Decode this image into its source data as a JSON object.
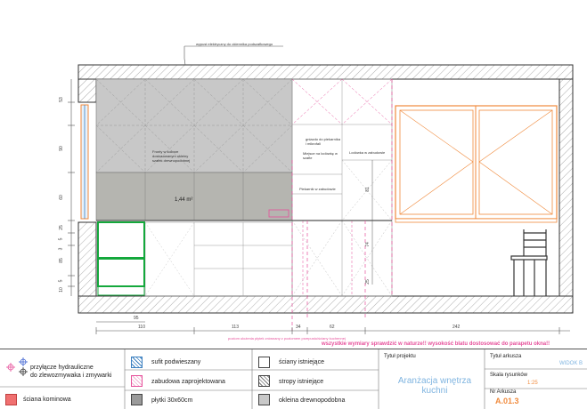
{
  "annotations": {
    "top_note": "wypust elektryczny do okiennika podszafkowego",
    "cabinet_note": "Fronty w kolorze dostosowanym okleiny szafek drewnopodobnej",
    "area": "1,44 m²",
    "oven_note": "gniazdo do piekarnika i mikrofali",
    "fridge_note": "Miejsce na lodówkę w szafie",
    "washer_note": "Lodówka w zabudowie",
    "piekarnik": "Piekarnik w zabudowie",
    "bottom_note": "poziom ułożenia płytek zrównany z poziomem przepustu/ściany kuchennej",
    "warning": "wszystkie wymiary sprawdzić w naturze!!  wysokość blatu dostosować do parapetu okna!!"
  },
  "dimensions": {
    "left_vertical": [
      "53",
      "90",
      "60",
      "25",
      "5",
      "3",
      "85",
      "5",
      "10"
    ],
    "bottom": [
      "110",
      "113",
      "34",
      "62",
      "242"
    ],
    "bottom_inner": "95",
    "right_inner": [
      "81",
      "74",
      "25"
    ]
  },
  "legend": {
    "items": [
      {
        "label": "przyłącze hydrauliczne\ndo zlewozmywaka i zmywarki"
      },
      {
        "label": "sufit podwieszany"
      },
      {
        "label": "ściany istniejące"
      },
      {
        "label": "zabudowa zaprojektowana"
      },
      {
        "label": "stropy istniejące"
      },
      {
        "label": "ściana kominowa"
      },
      {
        "label": "płytki 30x60cm"
      },
      {
        "label": "okleina drewnopodobna"
      }
    ],
    "project_title_label": "Tytuł projektu",
    "project_title": "Aranżacja wnętrza kuchni",
    "sheet_title_label": "Tytuł arkusza",
    "sheet_title": "WIDOK B",
    "scale_label": "Skala rysunków",
    "scale": "1:25",
    "sheet_no_label": "Nr Arkusza",
    "sheet_no": "A.01.3"
  },
  "colors": {
    "orange": "#f08a3c",
    "pink": "#e64f9a",
    "green": "#14a83c",
    "chimney": "#f07070"
  }
}
